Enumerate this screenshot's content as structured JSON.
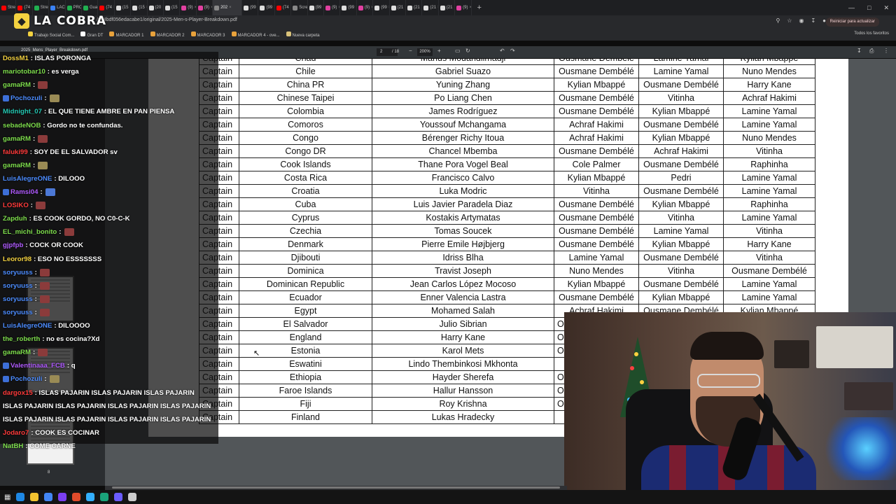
{
  "tabs": [
    {
      "label": "Stre",
      "color": "#ff0000"
    },
    {
      "label": "(74",
      "color": "#ff0000"
    },
    {
      "label": "Stre",
      "color": "#20b050"
    },
    {
      "label": "LAC",
      "color": "#3b82f6"
    },
    {
      "label": "PRC",
      "color": "#20b050"
    },
    {
      "label": "Gua",
      "color": "#20b050"
    },
    {
      "label": "(74",
      "color": "#ff0000"
    },
    {
      "label": "(15",
      "color": "#dddddd"
    },
    {
      "label": "(15",
      "color": "#dddddd"
    },
    {
      "label": "(20",
      "color": "#dddddd"
    },
    {
      "label": "(15",
      "color": "#dddddd"
    },
    {
      "label": "(9)",
      "color": "#e040a0"
    },
    {
      "label": "(9)",
      "color": "#e040a0"
    },
    {
      "label": "202",
      "color": "#888888"
    },
    {
      "label": "(99",
      "color": "#dddddd"
    },
    {
      "label": "(99",
      "color": "#dddddd"
    },
    {
      "label": "(74",
      "color": "#ff0000"
    },
    {
      "label": "Scre",
      "color": "#888888"
    },
    {
      "label": "(99",
      "color": "#dddddd"
    },
    {
      "label": "(9)",
      "color": "#e040a0"
    },
    {
      "label": "(99",
      "color": "#dddddd"
    },
    {
      "label": "(9)",
      "color": "#e040a0"
    },
    {
      "label": "(99",
      "color": "#dddddd"
    },
    {
      "label": "(21",
      "color": "#dddddd"
    },
    {
      "label": "(21",
      "color": "#dddddd"
    },
    {
      "label": "(21",
      "color": "#dddddd"
    },
    {
      "label": "(21",
      "color": "#dddddd"
    },
    {
      "label": "(9)",
      "color": "#e040a0"
    }
  ],
  "active_tab_index": 13,
  "address": {
    "url": "/m/4bdf056edacabe1/original/2025-Men-s-Player-Breakdown.pdf",
    "update_button": "Reiniciar para actualizar"
  },
  "bookmarks": [
    "Trabajo Social Com...",
    "Gran DT",
    "MARCADOR 1",
    "MARCADOR 2",
    "MARCADOR 3",
    "MARCADOR 4 - ove...",
    "Nueva carpeta"
  ],
  "all_favorites": "Todos los favoritos",
  "overlay_logo": "LA COBRA",
  "pdf": {
    "filename": "2025_Mens_Player_Breakdown.pdf",
    "page": "2",
    "page_total": "/ 18",
    "zoom": "200%"
  },
  "thumbnail_page": "8",
  "table": {
    "rows": [
      [
        "Captain",
        "Chad",
        "Marius Mouandilmadji",
        "Ousmane Dembélé",
        "Lamine Yamal",
        "Kylian Mbappé"
      ],
      [
        "Captain",
        "Chile",
        "Gabriel Suazo",
        "Ousmane Dembélé",
        "Lamine Yamal",
        "Nuno Mendes"
      ],
      [
        "Captain",
        "China PR",
        "Yuning Zhang",
        "Kylian Mbappé",
        "Ousmane Dembélé",
        "Harry Kane"
      ],
      [
        "Captain",
        "Chinese Taipei",
        "Po Liang Chen",
        "Ousmane Dembélé",
        "Vitinha",
        "Achraf Hakimi"
      ],
      [
        "Captain",
        "Colombia",
        "James Rodríguez",
        "Ousmane Dembélé",
        "Kylian Mbappé",
        "Lamine Yamal"
      ],
      [
        "Captain",
        "Comoros",
        "Youssouf Mchangama",
        "Achraf Hakimi",
        "Ousmane Dembélé",
        "Lamine Yamal"
      ],
      [
        "Captain",
        "Congo",
        "Bérenger Richy Itoua",
        "Achraf Hakimi",
        "Kylian Mbappé",
        "Nuno Mendes"
      ],
      [
        "Captain",
        "Congo DR",
        "Chancel Mbemba",
        "Ousmane Dembélé",
        "Achraf Hakimi",
        "Vitinha"
      ],
      [
        "Captain",
        "Cook Islands",
        "Thane Pora Vogel Beal",
        "Cole Palmer",
        "Ousmane Dembélé",
        "Raphinha"
      ],
      [
        "Captain",
        "Costa Rica",
        "Francisco Calvo",
        "Kylian Mbappé",
        "Pedri",
        "Lamine Yamal"
      ],
      [
        "Captain",
        "Croatia",
        "Luka Modric",
        "Vitinha",
        "Ousmane Dembélé",
        "Lamine Yamal"
      ],
      [
        "Captain",
        "Cuba",
        "Luis Javier Paradela Diaz",
        "Ousmane Dembélé",
        "Kylian Mbappé",
        "Raphinha"
      ],
      [
        "Captain",
        "Cyprus",
        "Kostakis Artymatas",
        "Ousmane Dembélé",
        "Vitinha",
        "Lamine Yamal"
      ],
      [
        "Captain",
        "Czechia",
        "Tomas Soucek",
        "Ousmane Dembélé",
        "Lamine Yamal",
        "Vitinha"
      ],
      [
        "Captain",
        "Denmark",
        "Pierre Emile Højbjerg",
        "Ousmane Dembélé",
        "Kylian Mbappé",
        "Harry Kane"
      ],
      [
        "Captain",
        "Djibouti",
        "Idriss Blha",
        "Lamine Yamal",
        "Ousmane Dembélé",
        "Vitinha"
      ],
      [
        "Captain",
        "Dominica",
        "Travist Joseph",
        "Nuno Mendes",
        "Vitinha",
        "Ousmane Dembélé"
      ],
      [
        "Captain",
        "Dominican Republic",
        "Jean Carlos López Mocoso",
        "Kylian Mbappé",
        "Ousmane Dembélé",
        "Lamine Yamal"
      ],
      [
        "Captain",
        "Ecuador",
        "Enner Valencia Lastra",
        "Ousmane Dembélé",
        "Kylian Mbappé",
        "Lamine Yamal"
      ],
      [
        "Captain",
        "Egypt",
        "Mohamed Salah",
        "Achraf Hakimi",
        "Ousmane Dembélé",
        "Kylian Mbappé"
      ],
      [
        "Captain",
        "El Salvador",
        "Julio Sibrian",
        "Ou",
        "",
        ""
      ],
      [
        "Captain",
        "England",
        "Harry Kane",
        "Ou",
        "",
        ""
      ],
      [
        "Captain",
        "Estonia",
        "Karol Mets",
        "Ou",
        "",
        ""
      ],
      [
        "Captain",
        "Eswatini",
        "Lindo Thembinkosi Mkhonta",
        "",
        "",
        ""
      ],
      [
        "Captain",
        "Ethiopia",
        "Hayder Sherefa",
        "Ou",
        "",
        ""
      ],
      [
        "Captain",
        "Faroe Islands",
        "Hallur Hansson",
        "Ou",
        "",
        ""
      ],
      [
        "Captain",
        "Fiji",
        "Roy Krishna",
        "Ou",
        "",
        ""
      ],
      [
        "Captain",
        "Finland",
        "Lukas Hradecky",
        "",
        "",
        ""
      ]
    ]
  },
  "chat": [
    {
      "user": "DossM1",
      "color": "#f4d240",
      "text": ": ISLAS PORONGA",
      "emote": ""
    },
    {
      "user": "mariotobar10",
      "color": "#7ddc4c",
      "text": ": es verga",
      "emote": ""
    },
    {
      "user": "gamaRM",
      "color": "#7ddc4c",
      "text": ":",
      "emote": "red"
    },
    {
      "user": "Pochozuli",
      "color": "#4c8cff",
      "text": ":",
      "emote": "alt",
      "badge": true
    },
    {
      "user": "Midnight_07",
      "color": "#23c6b1",
      "text": ": EL QUE TIENE AMBRE EN PAN PIENSA",
      "emote": ""
    },
    {
      "user": "sebadeNOB",
      "color": "#7ddc4c",
      "text": ": Gordo no te confundas.",
      "emote": ""
    },
    {
      "user": "gamaRM",
      "color": "#7ddc4c",
      "text": ":",
      "emote": "red"
    },
    {
      "user": "faluki99",
      "color": "#ff3a3a",
      "text": ": SOY DE EL SALVADOR sv",
      "emote": ""
    },
    {
      "user": "gamaRM",
      "color": "#7ddc4c",
      "text": ":",
      "emote": "alt"
    },
    {
      "user": "LuisAlegreONE",
      "color": "#4c8cff",
      "text": ": DILOOO",
      "emote": ""
    },
    {
      "user": "Ramsi04",
      "color": "#b05bff",
      "text": ":",
      "emote": "blue",
      "badge": true
    },
    {
      "user": "LOSIKO",
      "color": "#ff3a3a",
      "text": ":",
      "emote": "red"
    },
    {
      "user": "Zapduh",
      "color": "#7ddc4c",
      "text": ": ES COOK GORDO, NO C0-C-K",
      "emote": ""
    },
    {
      "user": "EL_michi_bonito",
      "color": "#7ddc4c",
      "text": ":",
      "emote": "red"
    },
    {
      "user": "gjpfpb",
      "color": "#b05bff",
      "text": ": COCK OR COOK",
      "emote": ""
    },
    {
      "user": "Leoror98",
      "color": "#f4d240",
      "text": ": ESO NO ESSSSSSS",
      "emote": ""
    },
    {
      "user": "soryuuss",
      "color": "#4c8cff",
      "text": ":",
      "emote": "red"
    },
    {
      "user": "soryuuss",
      "color": "#4c8cff",
      "text": ":",
      "emote": "red"
    },
    {
      "user": "soryuuss",
      "color": "#4c8cff",
      "text": ":",
      "emote": "red"
    },
    {
      "user": "soryuuss",
      "color": "#4c8cff",
      "text": ":",
      "emote": "red"
    },
    {
      "user": "LuisAlegreONE",
      "color": "#4c8cff",
      "text": ": DILOOOO",
      "emote": ""
    },
    {
      "user": "the_roberth",
      "color": "#7ddc4c",
      "text": ": no es cocina?Xd",
      "emote": ""
    },
    {
      "user": "gamaRM",
      "color": "#7ddc4c",
      "text": ":",
      "emote": "red"
    },
    {
      "user": "Valentinaaa_FCB",
      "color": "#b05bff",
      "text": ": q",
      "emote": "",
      "badge": true
    },
    {
      "user": "Pochozuli",
      "color": "#4c8cff",
      "text": ":",
      "emote": "alt",
      "badge": true
    },
    {
      "user": "dargox15",
      "color": "#ff3a3a",
      "text": ": ISLAS PAJARIN ISLAS PAJARIN ISLAS PAJARIN",
      "emote": ""
    },
    {
      "user": "",
      "color": "#ffffff",
      "text": "ISLAS PAJARIN ISLAS PAJARIN ISLAS PAJARIN ISLAS PAJARIN",
      "emote": ""
    },
    {
      "user": "",
      "color": "#ffffff",
      "text": "ISLAS PAJARIN ISLAS PAJARIN ISLAS PAJARIN ISLAS PAJARIN",
      "emote": ""
    },
    {
      "user": "Jodaro7",
      "color": "#ff3a3a",
      "text": ": COOK ES COCINAR",
      "emote": ""
    },
    {
      "user": "NatBH",
      "color": "#7ddc4c",
      "text": ": COME CARNE",
      "emote": ""
    }
  ],
  "taskbar_icons": [
    "#1e88e5",
    "#f4c430",
    "#4285f4",
    "#7b3ff2",
    "#e04b2b",
    "#33b0ff",
    "#1aa37a",
    "#6a5cff",
    "#cccccc"
  ]
}
